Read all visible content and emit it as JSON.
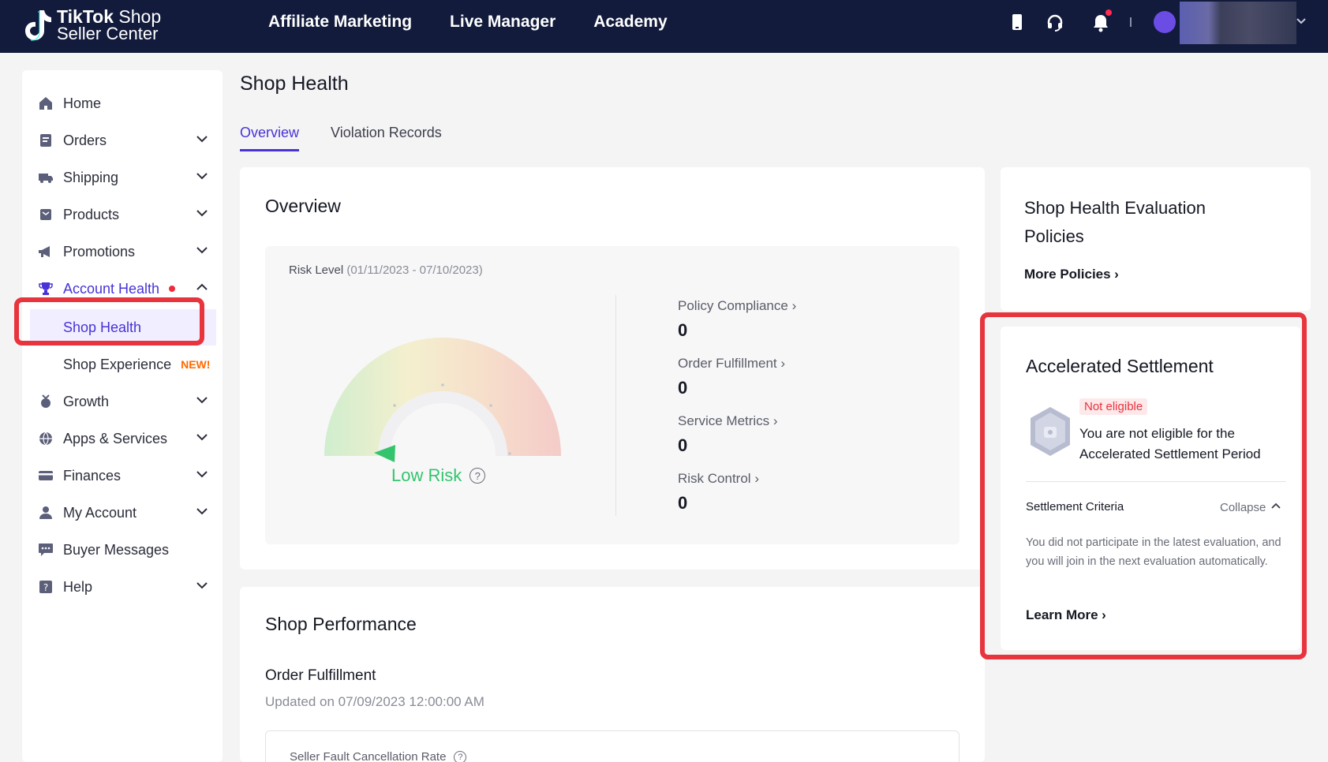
{
  "header": {
    "logo_line1_bold": "TikTok",
    "logo_line1_rest": " Shop",
    "logo_line2": "Seller Center",
    "nav": [
      "Affiliate Marketing",
      "Live Manager",
      "Academy"
    ]
  },
  "sidebar": {
    "items": [
      {
        "label": "Home",
        "icon": "home-icon"
      },
      {
        "label": "Orders",
        "icon": "orders-icon"
      },
      {
        "label": "Shipping",
        "icon": "shipping-icon"
      },
      {
        "label": "Products",
        "icon": "products-icon"
      },
      {
        "label": "Promotions",
        "icon": "megaphone-icon"
      },
      {
        "label": "Account Health",
        "icon": "trophy-icon"
      },
      {
        "label": "Growth",
        "icon": "growth-icon"
      },
      {
        "label": "Apps & Services",
        "icon": "globe-icon"
      },
      {
        "label": "Finances",
        "icon": "card-icon"
      },
      {
        "label": "My Account",
        "icon": "user-icon"
      },
      {
        "label": "Buyer Messages",
        "icon": "chat-icon"
      },
      {
        "label": "Help",
        "icon": "help-icon"
      }
    ],
    "sub_items": {
      "shop_health": "Shop Health",
      "shop_experience": "Shop Experience",
      "new_tag": "NEW!"
    }
  },
  "page": {
    "title": "Shop Health",
    "tabs": [
      "Overview",
      "Violation Records"
    ]
  },
  "overview": {
    "title": "Overview",
    "risk_label": "Risk Level",
    "risk_range": "(01/11/2023 - 07/10/2023)",
    "risk_status": "Low Risk",
    "metrics": [
      {
        "name": "Policy Compliance",
        "value": "0"
      },
      {
        "name": "Order Fulfillment",
        "value": "0"
      },
      {
        "name": "Service Metrics",
        "value": "0"
      },
      {
        "name": "Risk Control",
        "value": "0"
      }
    ]
  },
  "policies": {
    "title": "Shop Health Evaluation Policies",
    "link": "More Policies"
  },
  "settlement": {
    "title": "Accelerated Settlement",
    "badge": "Not eligible",
    "message": "You are not eligible for the Accelerated Settlement Period",
    "criteria_label": "Settlement Criteria",
    "collapse": "Collapse",
    "criteria_text": "You did not participate in the latest evaluation, and you will join in the next evaluation automatically.",
    "learn_more": "Learn More"
  },
  "performance": {
    "title": "Shop Performance",
    "subtitle": "Order Fulfillment",
    "updated": "Updated on 07/09/2023 12:00:00 AM",
    "first_metric": "Seller Fault Cancellation Rate"
  },
  "colors": {
    "accent": "#4733d6",
    "topbar": "#121b3c",
    "low_risk": "#34c46e",
    "highlight": "#e8343d"
  }
}
